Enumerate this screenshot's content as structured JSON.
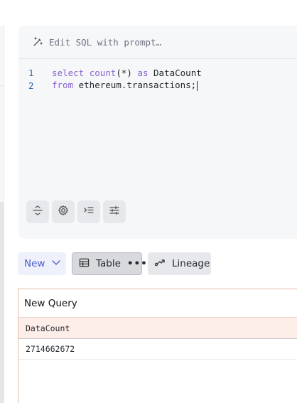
{
  "editor": {
    "prompt_placeholder": "Edit SQL with prompt…",
    "lines": [
      {
        "number": "1",
        "tokens": [
          {
            "text": "select",
            "kind": "keyword"
          },
          {
            "text": " ",
            "kind": "plain"
          },
          {
            "text": "count",
            "kind": "keyword"
          },
          {
            "text": "(*)",
            "kind": "plain"
          },
          {
            "text": " ",
            "kind": "plain"
          },
          {
            "text": "as",
            "kind": "keyword"
          },
          {
            "text": " DataCount",
            "kind": "plain"
          }
        ]
      },
      {
        "number": "2",
        "tokens": [
          {
            "text": "from",
            "kind": "keyword"
          },
          {
            "text": " ethereum.transactions;",
            "kind": "plain"
          }
        ]
      }
    ],
    "tools": [
      {
        "name": "collapse-icon"
      },
      {
        "name": "gear-icon"
      },
      {
        "name": "format-indent-icon"
      },
      {
        "name": "sliders-icon"
      }
    ]
  },
  "toolbar": {
    "new_label": "New",
    "table_label": "Table",
    "table_more": "•••",
    "lineage_label": "Lineage"
  },
  "results": {
    "title": "New Query",
    "columns": [
      "DataCount"
    ],
    "rows": [
      [
        "2714662672"
      ]
    ]
  },
  "colors": {
    "keyword": "#8a63d2",
    "line_number": "#2f6fb0",
    "accent": "#4b5cc4",
    "results_border": "#e7b9a8",
    "header_bg": "#fdeee9"
  }
}
